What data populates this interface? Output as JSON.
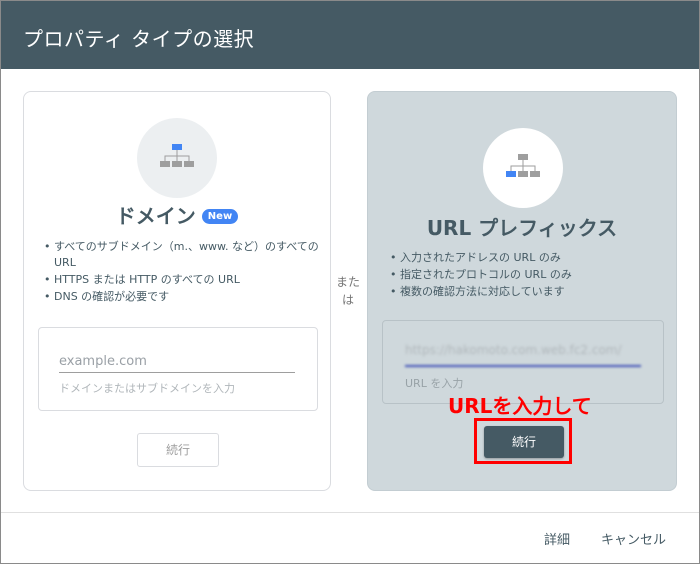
{
  "dialog": {
    "title": "プロパティ タイプの選択",
    "or_label": "または"
  },
  "domain_card": {
    "heading": "ドメイン",
    "badge": "New",
    "icon": "sitemap-icon",
    "features": [
      "すべてのサブドメイン（m.、www. など）のすべての URL",
      "HTTPS または HTTP のすべての URL",
      "DNS の確認が必要です"
    ],
    "input_placeholder": "example.com",
    "input_helper": "ドメインまたはサブドメインを入力",
    "continue_label": "続行"
  },
  "url_prefix_card": {
    "heading": "URL プレフィックス",
    "icon": "sitemap-icon",
    "features": [
      "入力されたアドレスの URL のみ",
      "指定されたプロトコルの URL のみ",
      "複数の確認方法に対応しています"
    ],
    "input_value": "https://hakomoto.com.web.fc2.com/",
    "input_helper": "URL を入力",
    "continue_label": "続行",
    "annotation": "URLを入力して"
  },
  "footer": {
    "details_label": "詳細",
    "cancel_label": "キャンセル"
  },
  "colors": {
    "header_bg": "#455a64",
    "selected_card_bg": "#cfd8dc",
    "accent": "#4285f4",
    "annotation": "#ff0000"
  }
}
